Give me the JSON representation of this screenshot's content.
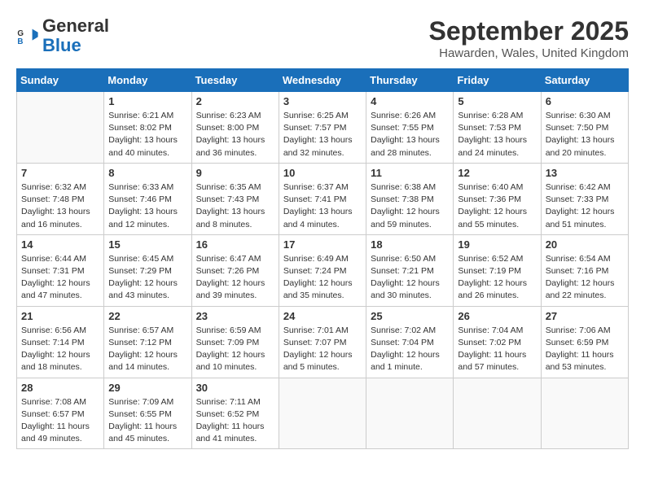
{
  "header": {
    "logo_line1": "General",
    "logo_line2": "Blue",
    "month_title": "September 2025",
    "location": "Hawarden, Wales, United Kingdom"
  },
  "weekdays": [
    "Sunday",
    "Monday",
    "Tuesday",
    "Wednesday",
    "Thursday",
    "Friday",
    "Saturday"
  ],
  "weeks": [
    [
      {
        "day": "",
        "info": ""
      },
      {
        "day": "1",
        "info": "Sunrise: 6:21 AM\nSunset: 8:02 PM\nDaylight: 13 hours\nand 40 minutes."
      },
      {
        "day": "2",
        "info": "Sunrise: 6:23 AM\nSunset: 8:00 PM\nDaylight: 13 hours\nand 36 minutes."
      },
      {
        "day": "3",
        "info": "Sunrise: 6:25 AM\nSunset: 7:57 PM\nDaylight: 13 hours\nand 32 minutes."
      },
      {
        "day": "4",
        "info": "Sunrise: 6:26 AM\nSunset: 7:55 PM\nDaylight: 13 hours\nand 28 minutes."
      },
      {
        "day": "5",
        "info": "Sunrise: 6:28 AM\nSunset: 7:53 PM\nDaylight: 13 hours\nand 24 minutes."
      },
      {
        "day": "6",
        "info": "Sunrise: 6:30 AM\nSunset: 7:50 PM\nDaylight: 13 hours\nand 20 minutes."
      }
    ],
    [
      {
        "day": "7",
        "info": "Sunrise: 6:32 AM\nSunset: 7:48 PM\nDaylight: 13 hours\nand 16 minutes."
      },
      {
        "day": "8",
        "info": "Sunrise: 6:33 AM\nSunset: 7:46 PM\nDaylight: 13 hours\nand 12 minutes."
      },
      {
        "day": "9",
        "info": "Sunrise: 6:35 AM\nSunset: 7:43 PM\nDaylight: 13 hours\nand 8 minutes."
      },
      {
        "day": "10",
        "info": "Sunrise: 6:37 AM\nSunset: 7:41 PM\nDaylight: 13 hours\nand 4 minutes."
      },
      {
        "day": "11",
        "info": "Sunrise: 6:38 AM\nSunset: 7:38 PM\nDaylight: 12 hours\nand 59 minutes."
      },
      {
        "day": "12",
        "info": "Sunrise: 6:40 AM\nSunset: 7:36 PM\nDaylight: 12 hours\nand 55 minutes."
      },
      {
        "day": "13",
        "info": "Sunrise: 6:42 AM\nSunset: 7:33 PM\nDaylight: 12 hours\nand 51 minutes."
      }
    ],
    [
      {
        "day": "14",
        "info": "Sunrise: 6:44 AM\nSunset: 7:31 PM\nDaylight: 12 hours\nand 47 minutes."
      },
      {
        "day": "15",
        "info": "Sunrise: 6:45 AM\nSunset: 7:29 PM\nDaylight: 12 hours\nand 43 minutes."
      },
      {
        "day": "16",
        "info": "Sunrise: 6:47 AM\nSunset: 7:26 PM\nDaylight: 12 hours\nand 39 minutes."
      },
      {
        "day": "17",
        "info": "Sunrise: 6:49 AM\nSunset: 7:24 PM\nDaylight: 12 hours\nand 35 minutes."
      },
      {
        "day": "18",
        "info": "Sunrise: 6:50 AM\nSunset: 7:21 PM\nDaylight: 12 hours\nand 30 minutes."
      },
      {
        "day": "19",
        "info": "Sunrise: 6:52 AM\nSunset: 7:19 PM\nDaylight: 12 hours\nand 26 minutes."
      },
      {
        "day": "20",
        "info": "Sunrise: 6:54 AM\nSunset: 7:16 PM\nDaylight: 12 hours\nand 22 minutes."
      }
    ],
    [
      {
        "day": "21",
        "info": "Sunrise: 6:56 AM\nSunset: 7:14 PM\nDaylight: 12 hours\nand 18 minutes."
      },
      {
        "day": "22",
        "info": "Sunrise: 6:57 AM\nSunset: 7:12 PM\nDaylight: 12 hours\nand 14 minutes."
      },
      {
        "day": "23",
        "info": "Sunrise: 6:59 AM\nSunset: 7:09 PM\nDaylight: 12 hours\nand 10 minutes."
      },
      {
        "day": "24",
        "info": "Sunrise: 7:01 AM\nSunset: 7:07 PM\nDaylight: 12 hours\nand 5 minutes."
      },
      {
        "day": "25",
        "info": "Sunrise: 7:02 AM\nSunset: 7:04 PM\nDaylight: 12 hours\nand 1 minute."
      },
      {
        "day": "26",
        "info": "Sunrise: 7:04 AM\nSunset: 7:02 PM\nDaylight: 11 hours\nand 57 minutes."
      },
      {
        "day": "27",
        "info": "Sunrise: 7:06 AM\nSunset: 6:59 PM\nDaylight: 11 hours\nand 53 minutes."
      }
    ],
    [
      {
        "day": "28",
        "info": "Sunrise: 7:08 AM\nSunset: 6:57 PM\nDaylight: 11 hours\nand 49 minutes."
      },
      {
        "day": "29",
        "info": "Sunrise: 7:09 AM\nSunset: 6:55 PM\nDaylight: 11 hours\nand 45 minutes."
      },
      {
        "day": "30",
        "info": "Sunrise: 7:11 AM\nSunset: 6:52 PM\nDaylight: 11 hours\nand 41 minutes."
      },
      {
        "day": "",
        "info": ""
      },
      {
        "day": "",
        "info": ""
      },
      {
        "day": "",
        "info": ""
      },
      {
        "day": "",
        "info": ""
      }
    ]
  ]
}
